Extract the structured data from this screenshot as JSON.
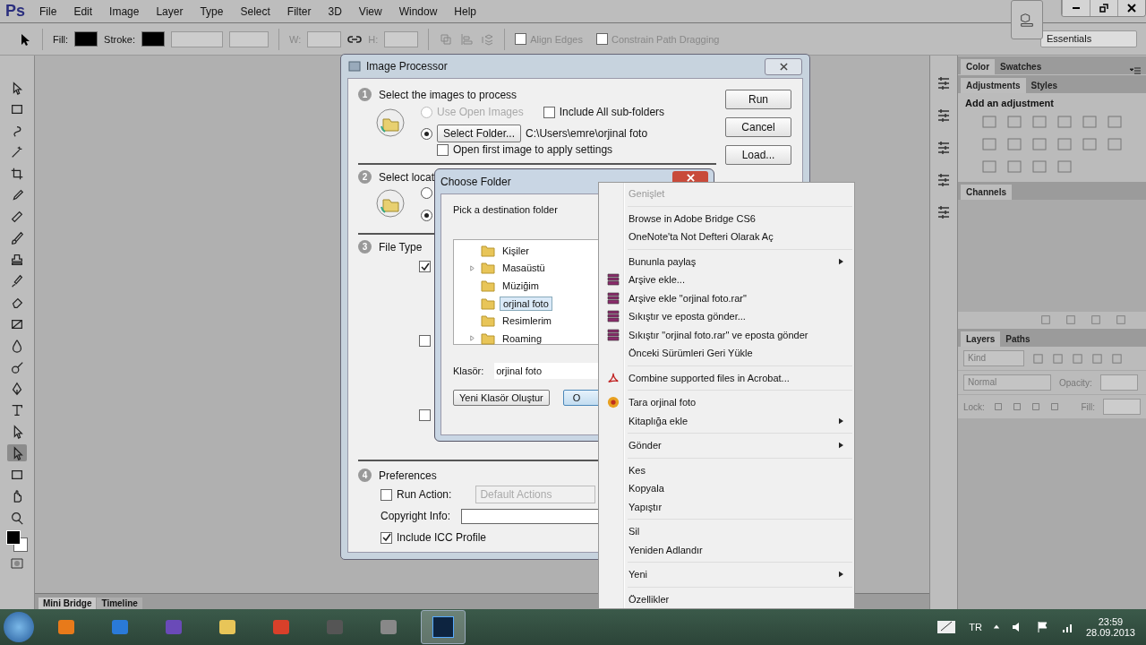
{
  "app_logo": "Ps",
  "menu_bar": [
    "File",
    "Edit",
    "Image",
    "Layer",
    "Type",
    "Select",
    "Filter",
    "3D",
    "View",
    "Window",
    "Help"
  ],
  "options_bar": {
    "fill_label": "Fill:",
    "stroke_label": "Stroke:",
    "w_label": "W:",
    "h_label": "H:",
    "align_edges": {
      "label": "Align Edges",
      "checked": false
    },
    "constrain": {
      "label": "Constrain Path Dragging",
      "checked": false
    },
    "workspace": "Essentials"
  },
  "tools": [
    {
      "selected": false
    },
    {
      "selected": false
    },
    {
      "selected": false
    },
    {
      "selected": false
    },
    {
      "selected": false
    },
    {
      "selected": false
    },
    {
      "selected": false
    },
    {
      "selected": false
    },
    {
      "selected": false
    },
    {
      "selected": false
    },
    {
      "selected": false
    },
    {
      "selected": false
    },
    {
      "selected": false
    },
    {
      "selected": false
    },
    {
      "selected": false
    },
    {
      "selected": false
    },
    {
      "selected": false
    },
    {
      "selected": true
    },
    {
      "selected": false
    },
    {
      "selected": false
    },
    {
      "selected": false
    }
  ],
  "image_processor": {
    "title": "Image Processor",
    "buttons": [
      "Run",
      "Cancel",
      "Load..."
    ],
    "section_1": {
      "number": "1",
      "title": "Select the images to process",
      "use_open": {
        "label": "Use Open Images",
        "selected": false,
        "disabled": true
      },
      "subfolders": {
        "label": "Include All sub-folders",
        "checked": false
      },
      "folder": {
        "button": "Select Folder...",
        "selected": true
      },
      "path": "C:\\Users\\emre\\orjinal foto",
      "open_first": {
        "label": "Open first image to apply settings",
        "checked": false
      }
    },
    "section_2": {
      "number": "2",
      "title": "Select locat",
      "radios": [
        {
          "selected": false
        },
        {
          "selected": true
        }
      ]
    },
    "section_3": {
      "number": "3",
      "title": "File Type",
      "checkboxes": [
        {
          "checked": true
        },
        {
          "checked": false
        },
        {
          "checked": false
        }
      ]
    },
    "section_4": {
      "number": "4",
      "title": "Preferences",
      "run_action": {
        "label": "Run Action:",
        "checked": false
      },
      "action_set": "Default Actions",
      "copyright_label": "Copyright Info:",
      "icc": {
        "label": "Include ICC Profile",
        "checked": true
      }
    }
  },
  "choose_folder": {
    "title": "Choose Folder",
    "prompt": "Pick a destination folder",
    "tree": [
      {
        "label": "Kişiler",
        "expandable": false,
        "selected": false
      },
      {
        "label": "Masaüstü",
        "expandable": true,
        "selected": false
      },
      {
        "label": "Müziğim",
        "expandable": false,
        "selected": false
      },
      {
        "label": "orjinal foto",
        "expandable": false,
        "selected": true
      },
      {
        "label": "Resimlerim",
        "expandable": false,
        "selected": false
      },
      {
        "label": "Roaming",
        "expandable": true,
        "selected": false
      }
    ],
    "folder_label": "Klasör:",
    "folder_value": "orjinal foto",
    "new_folder_button": "Yeni Klasör Oluştur",
    "ok_button": "O"
  },
  "context_menu": [
    {
      "kind": "item",
      "label": "Genişlet",
      "disabled": true
    },
    {
      "kind": "separator"
    },
    {
      "kind": "item",
      "label": "Browse in Adobe Bridge CS6"
    },
    {
      "kind": "item",
      "label": "OneNote'ta Not Defteri Olarak Aç"
    },
    {
      "kind": "separator"
    },
    {
      "kind": "item",
      "label": "Bununla paylaş",
      "submenu": true
    },
    {
      "kind": "item",
      "label": "Arşive ekle..."
    },
    {
      "kind": "item",
      "label": "Arşive ekle \"orjinal foto.rar\""
    },
    {
      "kind": "item",
      "label": "Sıkıştır ve eposta gönder..."
    },
    {
      "kind": "item",
      "label": "Sıkıştır \"orjinal foto.rar\" ve eposta gönder"
    },
    {
      "kind": "item",
      "label": "Önceki Sürümleri Geri Yükle"
    },
    {
      "kind": "separator"
    },
    {
      "kind": "item",
      "label": "Combine supported files in Acrobat..."
    },
    {
      "kind": "separator"
    },
    {
      "kind": "item",
      "label": "Tara orjinal foto"
    },
    {
      "kind": "item",
      "label": "Kitaplığa ekle",
      "submenu": true
    },
    {
      "kind": "separator"
    },
    {
      "kind": "item",
      "label": "Gönder",
      "submenu": true
    },
    {
      "kind": "separator"
    },
    {
      "kind": "item",
      "label": "Kes"
    },
    {
      "kind": "item",
      "label": "Kopyala"
    },
    {
      "kind": "item",
      "label": "Yapıştır"
    },
    {
      "kind": "separator"
    },
    {
      "kind": "item",
      "label": "Sil"
    },
    {
      "kind": "item",
      "label": "Yeniden Adlandır"
    },
    {
      "kind": "separator"
    },
    {
      "kind": "item",
      "label": "Yeni",
      "submenu": true
    },
    {
      "kind": "separator"
    },
    {
      "kind": "item",
      "label": "Özellikler"
    }
  ],
  "panels": {
    "color_tabs": [
      {
        "label": "Color",
        "selected": true
      },
      {
        "label": "Swatches",
        "selected": false
      }
    ],
    "adjust_tabs": [
      {
        "label": "Adjustments",
        "selected": true
      },
      {
        "label": "Styles",
        "selected": false
      }
    ],
    "adjust_heading": "Add an adjustment",
    "channels_tab": "Channels",
    "layer_tabs": [
      {
        "label": "Layers",
        "selected": true
      },
      {
        "label": "Paths",
        "selected": false
      }
    ],
    "kind_filter": "Kind",
    "blend_mode": "Normal",
    "opacity_label": "Opacity:",
    "lock_label": "Lock:",
    "fill_label": "Fill:"
  },
  "bottom_tabs": [
    {
      "label": "Mini Bridge",
      "selected": true
    },
    {
      "label": "Timeline",
      "selected": false
    }
  ],
  "taskbar": {
    "language": "TR",
    "time": "23:59",
    "date": "28.09.2013"
  }
}
